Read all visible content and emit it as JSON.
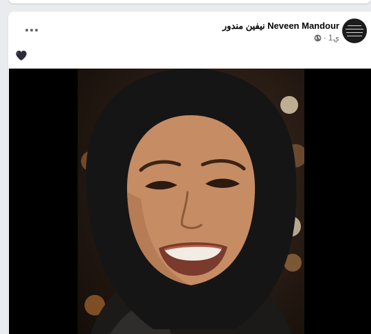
{
  "post": {
    "author_name": "نيفين مندور Neveen Mandour",
    "time": "1ي",
    "dot_separator": "·",
    "privacy_icon": "globe-icon",
    "more_icon": "more-options-icon",
    "avatar_icon": "avatar",
    "text_emoji": "🖤",
    "photo_icon": "post-photo"
  },
  "colors": {
    "page_background": "#e9ebee",
    "card_background": "#ffffff",
    "secondary_text": "#65676b",
    "primary_text": "#050505"
  }
}
